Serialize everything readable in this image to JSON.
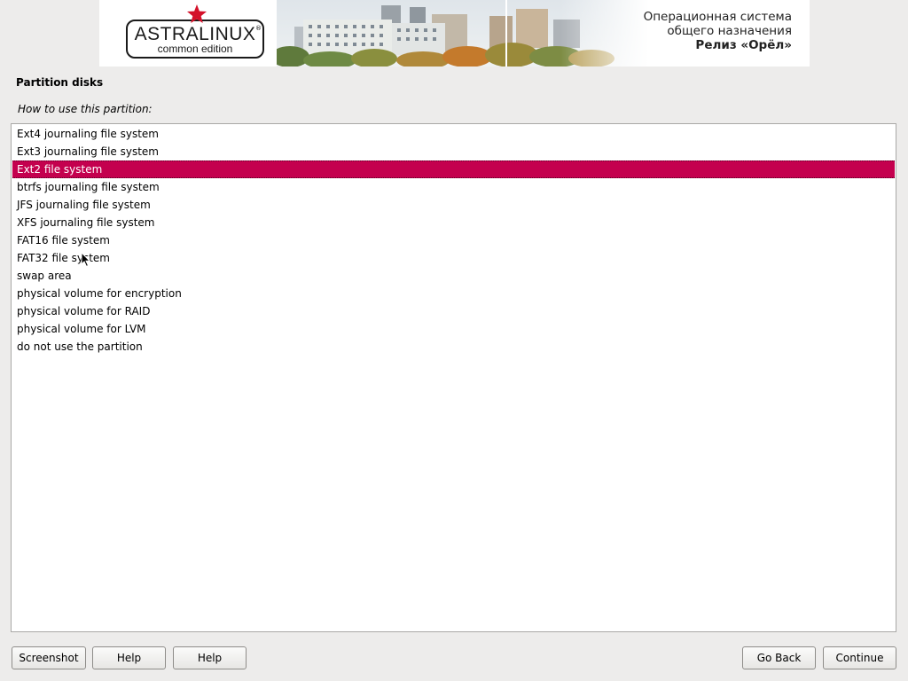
{
  "banner": {
    "logo_name": "ASTRALINUX",
    "logo_registered": "®",
    "logo_edition": "common edition",
    "os_line1": "Операционная система",
    "os_line2": "общего назначения",
    "release": "Релиз «Орёл»"
  },
  "page": {
    "title": "Partition disks",
    "question": "How to use this partition:"
  },
  "options": [
    "Ext4 journaling file system",
    "Ext3 journaling file system",
    "Ext2 file system",
    "btrfs journaling file system",
    "JFS journaling file system",
    "XFS journaling file system",
    "FAT16 file system",
    "FAT32 file system",
    "swap area",
    "physical volume for encryption",
    "physical volume for RAID",
    "physical volume for LVM",
    "do not use the partition"
  ],
  "selected_option": "Ext2 file system",
  "buttons": {
    "screenshot": "Screenshot",
    "help1": "Help",
    "help2": "Help",
    "go_back": "Go Back",
    "continue": "Continue"
  },
  "colors": {
    "selection": "#c4004e",
    "background": "#edeceb"
  }
}
